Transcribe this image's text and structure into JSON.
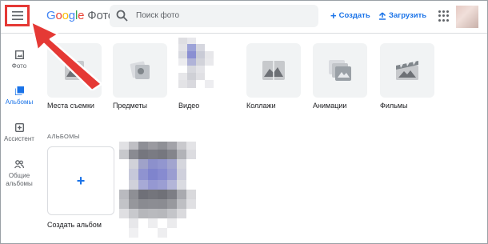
{
  "header": {
    "logo_google": [
      "G",
      "o",
      "o",
      "g",
      "l",
      "e"
    ],
    "logo_product": "Фото",
    "search_placeholder": "Поиск фото",
    "create_label": "Создать",
    "upload_label": "Загрузить"
  },
  "sidebar": {
    "items": [
      {
        "label": "Фото"
      },
      {
        "label": "Альбомы"
      },
      {
        "label": "Ассистент"
      },
      {
        "label": "Общие альбомы"
      }
    ]
  },
  "categories": [
    {
      "label": "Места съемки",
      "icon": "landscape-icon"
    },
    {
      "label": "Предметы",
      "icon": "objects-icon"
    },
    {
      "label": "Видео",
      "icon": "video-thumbnail"
    },
    {
      "label": "Коллажи",
      "icon": "collage-icon"
    },
    {
      "label": "Анимации",
      "icon": "animation-icon"
    },
    {
      "label": "Фильмы",
      "icon": "movie-icon"
    }
  ],
  "albums_section": {
    "title": "АЛЬБОМЫ",
    "create_label": "Создать альбом"
  },
  "colors": {
    "accent": "#1a73e8",
    "highlight": "#e53935"
  }
}
